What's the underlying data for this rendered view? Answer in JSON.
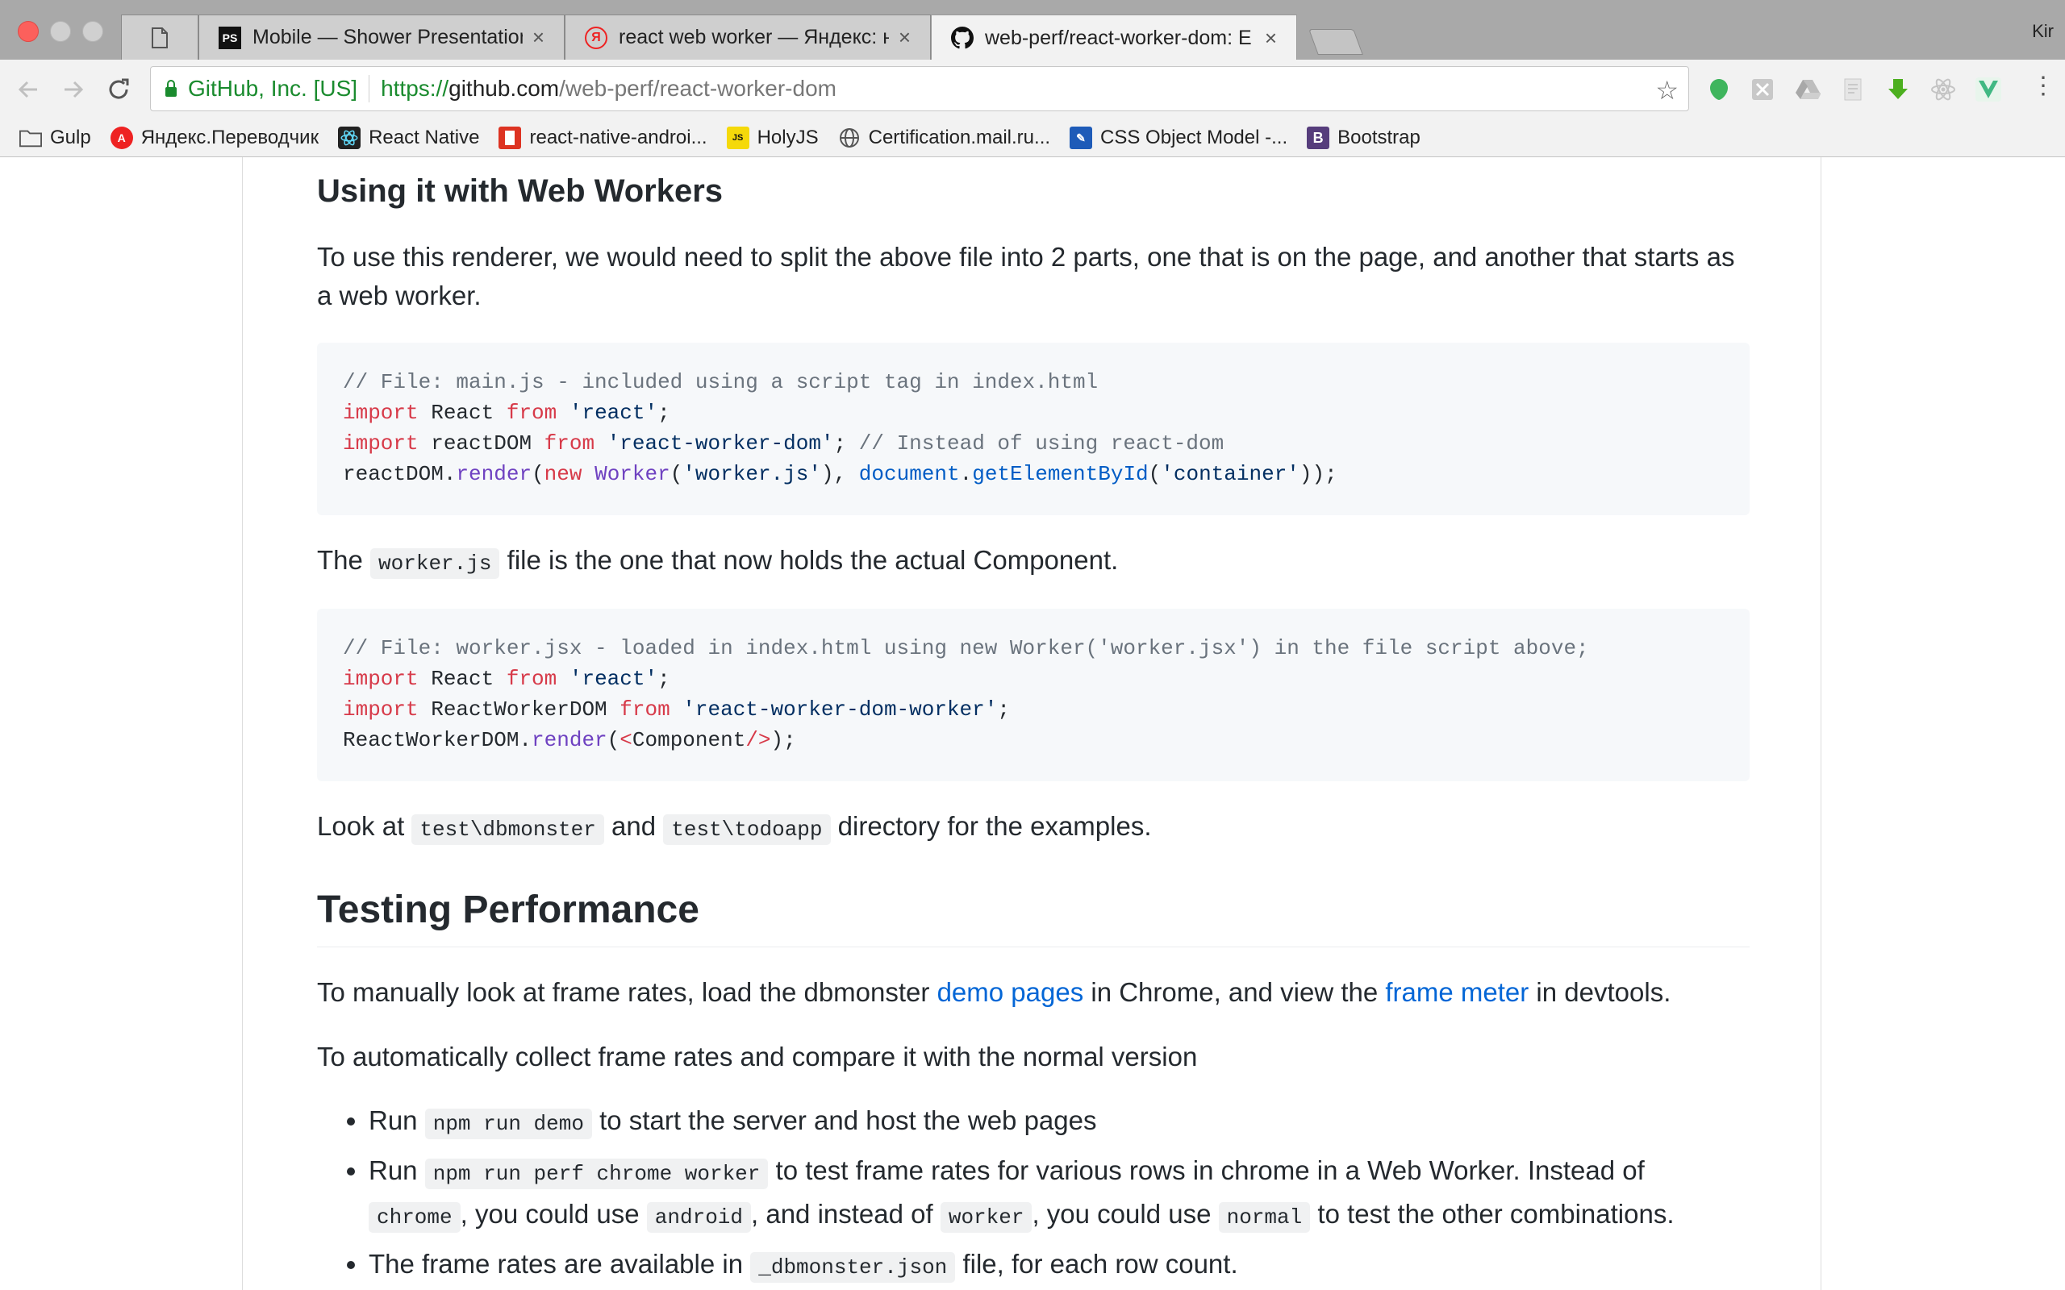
{
  "browser": {
    "profile_name": "Kir",
    "tabs": [
      {
        "title": "",
        "favicon": "blank-page-icon"
      },
      {
        "title": "Mobile — Shower Presentation",
        "favicon": "ps-icon"
      },
      {
        "title": "react web worker — Яндекс: н",
        "favicon": "yandex-icon"
      },
      {
        "title": "web-perf/react-worker-dom: E",
        "favicon": "github-icon"
      }
    ],
    "toolbar": {
      "ev_name": "GitHub, Inc. [US]",
      "url_scheme": "https://",
      "url_host": "github.com",
      "url_path": "/web-perf/react-worker-dom"
    },
    "bookmarks": [
      {
        "label": "Gulp",
        "icon": "folder-icon"
      },
      {
        "label": "Яндекс.Переводчик",
        "icon": "yandex-translate-icon"
      },
      {
        "label": "React Native",
        "icon": "react-icon"
      },
      {
        "label": "react-native-androi...",
        "icon": "red-box-icon"
      },
      {
        "label": "HolyJS",
        "icon": "holyjs-icon"
      },
      {
        "label": "Certification.mail.ru...",
        "icon": "globe-icon"
      },
      {
        "label": "CSS Object Model -...",
        "icon": "css-icon"
      },
      {
        "label": "Bootstrap",
        "icon": "bootstrap-icon"
      }
    ]
  },
  "article": {
    "heading_workers": "Using it with Web Workers",
    "para_split": "To use this renderer, we would need to split the above file into 2 parts, one that is on the page, and another that starts as a web worker.",
    "code1": {
      "line1": "// File: main.js - included using a script tag in index.html",
      "l2_kw": "import",
      "l2_id": " React ",
      "l2_from": "from",
      "l2_str": "'react'",
      "l2_end": ";",
      "l3_kw": "import",
      "l3_id": " reactDOM ",
      "l3_from": "from",
      "l3_str": "'react-worker-dom'",
      "l3_mid": "; ",
      "l3_com": "// Instead of using react-dom",
      "l4_a": "reactDOM.",
      "l4_fn": "render",
      "l4_b": "(",
      "l4_new": "new",
      "l4_c": " ",
      "l4_cls": "Worker",
      "l4_d": "(",
      "l4_str": "'worker.js'",
      "l4_e": "), ",
      "l4_doc": "document",
      "l4_f": ".",
      "l4_get": "getElementById",
      "l4_g": "(",
      "l4_str2": "'container'",
      "l4_h": "));"
    },
    "para_worker_pre": "The ",
    "para_worker_code": "worker.js",
    "para_worker_post": " file is the one that now holds the actual Component.",
    "code2": {
      "line1": "// File: worker.jsx - loaded in index.html using new Worker('worker.jsx') in the file script above;",
      "l2_kw": "import",
      "l2_id": " React ",
      "l2_from": "from",
      "l2_str": "'react'",
      "l2_end": ";",
      "l3_kw": "import",
      "l3_id": " ReactWorkerDOM ",
      "l3_from": "from",
      "l3_str": "'react-worker-dom-worker'",
      "l3_end": ";",
      "l4_a": "ReactWorkerDOM.",
      "l4_fn": "render",
      "l4_b": "(",
      "l4_lt": "<",
      "l4_tag": "Component",
      "l4_close": "/>",
      "l4_end": ");"
    },
    "para_look_pre": "Look at ",
    "para_look_code1": "test\\dbmonster",
    "para_look_mid": " and ",
    "para_look_code2": "test\\todoapp",
    "para_look_post": " directory for the examples.",
    "heading_perf": "Testing Performance",
    "para_manual_pre": "To manually look at frame rates, load the dbmonster ",
    "para_manual_link1": "demo pages",
    "para_manual_mid": " in Chrome, and view the ",
    "para_manual_link2": "frame meter",
    "para_manual_post": " in devtools.",
    "para_auto": "To automatically collect frame rates and compare it with the normal version",
    "bullets": {
      "b1_pre": "Run ",
      "b1_code": "npm run demo",
      "b1_post": " to start the server and host the web pages",
      "b2_pre": "Run ",
      "b2_code": "npm run perf chrome worker",
      "b2_mid1": " to test frame rates for various rows in chrome in a Web Worker. Instead of ",
      "b2_code2": "chrome",
      "b2_mid2": ", you could use ",
      "b2_code3": "android",
      "b2_mid3": ", and instead of ",
      "b2_code4": "worker",
      "b2_mid4": ", you could use ",
      "b2_code5": "normal",
      "b2_post": " to test the other combinations.",
      "b3_pre": "The frame rates are available in ",
      "b3_code": "_dbmonster.json",
      "b3_post": " file, for each row count."
    }
  }
}
